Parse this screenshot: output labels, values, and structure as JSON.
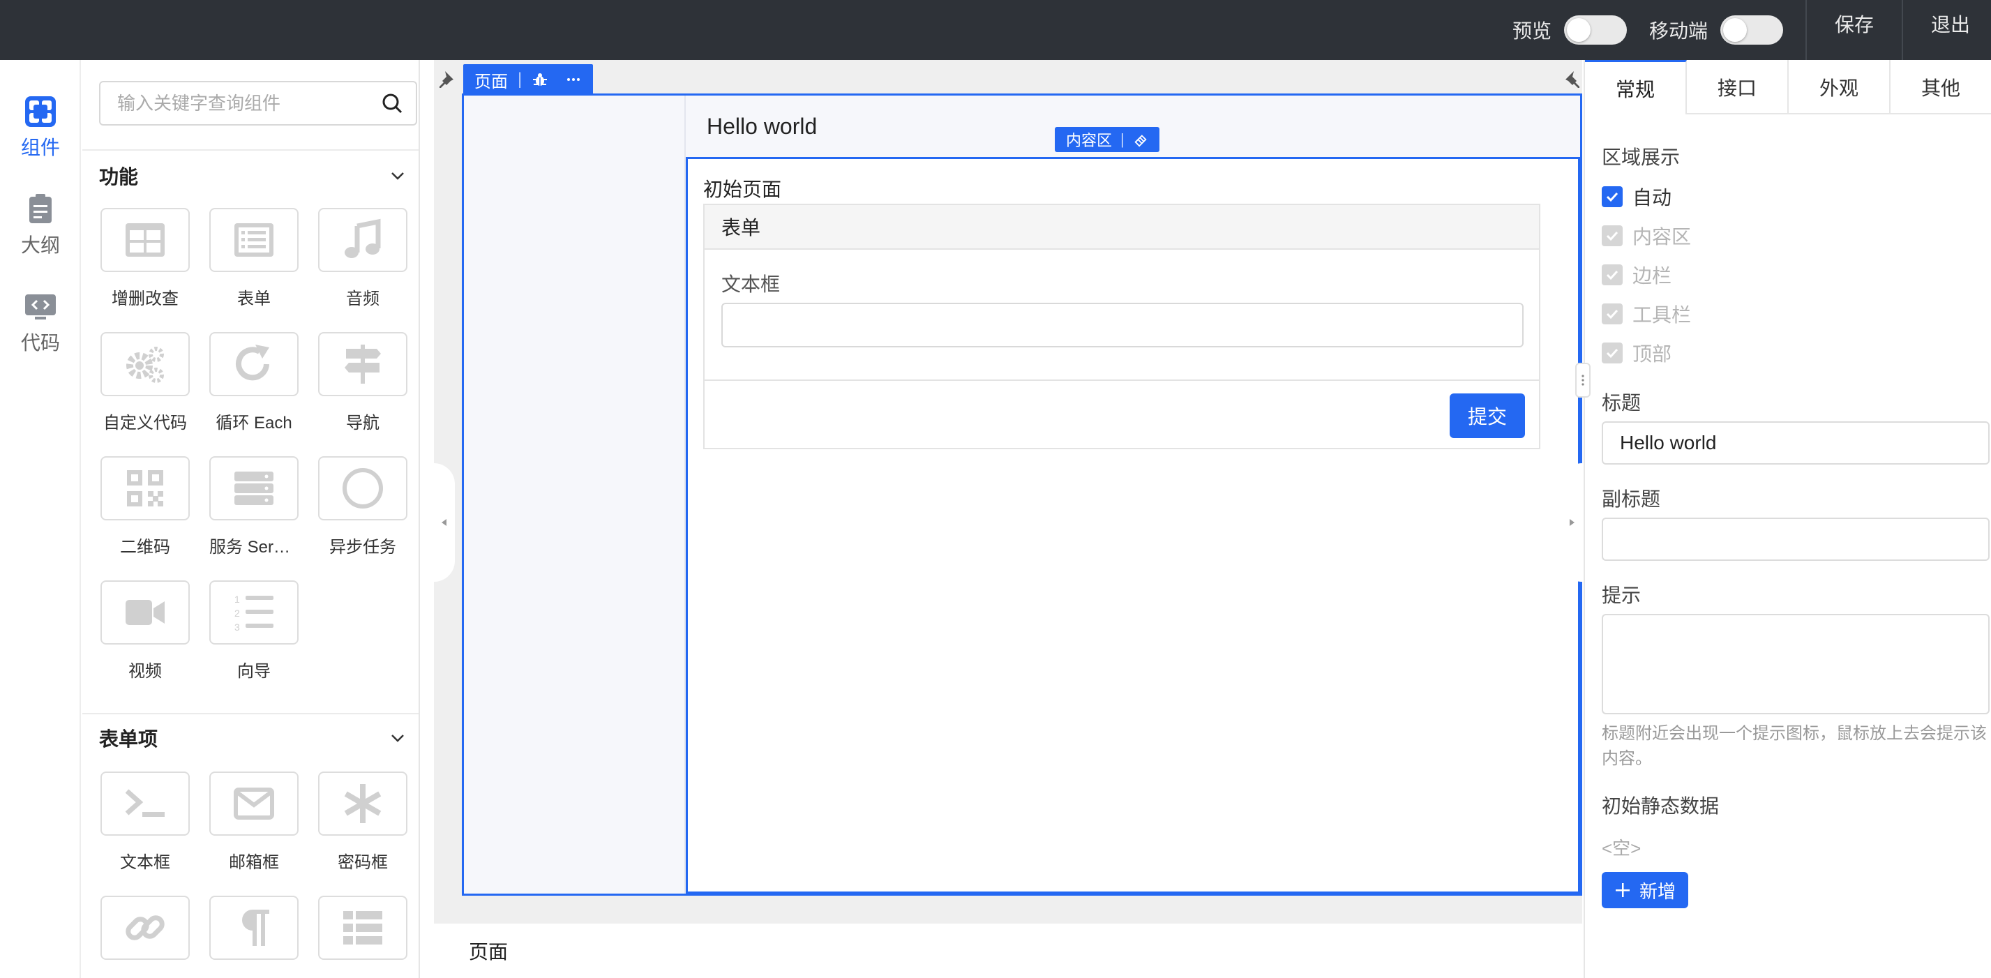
{
  "header": {
    "preview_label": "预览",
    "mobile_label": "移动端",
    "save_label": "保存",
    "exit_label": "退出"
  },
  "rail": {
    "items": [
      {
        "label": "组件",
        "icon": "component-icon",
        "active": true
      },
      {
        "label": "大纲",
        "icon": "outline-icon",
        "active": false
      },
      {
        "label": "代码",
        "icon": "code-icon",
        "active": false
      }
    ]
  },
  "components": {
    "search_placeholder": "输入关键字查询组件",
    "groups": [
      {
        "title": "功能",
        "items": [
          {
            "label": "增删改查",
            "icon": "crud-icon"
          },
          {
            "label": "表单",
            "icon": "form-icon"
          },
          {
            "label": "音频",
            "icon": "music-icon"
          },
          {
            "label": "自定义代码",
            "icon": "gears-icon"
          },
          {
            "label": "循环 Each",
            "icon": "redo-icon"
          },
          {
            "label": "导航",
            "icon": "signpost-icon"
          },
          {
            "label": "二维码",
            "icon": "qrcode-icon"
          },
          {
            "label": "服务 Service",
            "icon": "server-icon"
          },
          {
            "label": "异步任务",
            "icon": "circle-icon"
          },
          {
            "label": "视频",
            "icon": "video-icon"
          },
          {
            "label": "向导",
            "icon": "ordered-list-icon"
          }
        ]
      },
      {
        "title": "表单项",
        "items": [
          {
            "label": "文本框",
            "icon": "terminal-icon"
          },
          {
            "label": "邮箱框",
            "icon": "envelope-icon"
          },
          {
            "label": "密码框",
            "icon": "asterisk-icon"
          },
          {
            "label": "",
            "icon": "link-icon"
          },
          {
            "label": "",
            "icon": "paragraph-icon"
          },
          {
            "label": "",
            "icon": "list-icon"
          }
        ]
      }
    ]
  },
  "canvas": {
    "page_tag": "页面",
    "page_header_title": "Hello world",
    "content_tag": "内容区",
    "init_title": "初始页面",
    "form": {
      "title": "表单",
      "field_label": "文本框",
      "submit_label": "提交"
    },
    "breadcrumb": "页面"
  },
  "props": {
    "tabs": [
      "常规",
      "接口",
      "外观",
      "其他"
    ],
    "region_label": "区域展示",
    "region_options": [
      {
        "label": "自动",
        "checked": true,
        "disabled": false
      },
      {
        "label": "内容区",
        "checked": true,
        "disabled": true
      },
      {
        "label": "边栏",
        "checked": true,
        "disabled": true
      },
      {
        "label": "工具栏",
        "checked": true,
        "disabled": true
      },
      {
        "label": "顶部",
        "checked": true,
        "disabled": true
      }
    ],
    "title_label": "标题",
    "title_value": "Hello world",
    "subtitle_label": "副标题",
    "subtitle_value": "",
    "remark_label": "提示",
    "remark_value": "",
    "remark_hint": "标题附近会出现一个提示图标，鼠标放上去会提示该内容。",
    "init_data_label": "初始静态数据",
    "init_data_empty": "<空>",
    "add_label": "新增"
  },
  "colors": {
    "accent": "#2468f2",
    "header_bg": "#2e3238",
    "canvas_bg": "#efefef",
    "icon_gray": "#d0d0d0"
  }
}
